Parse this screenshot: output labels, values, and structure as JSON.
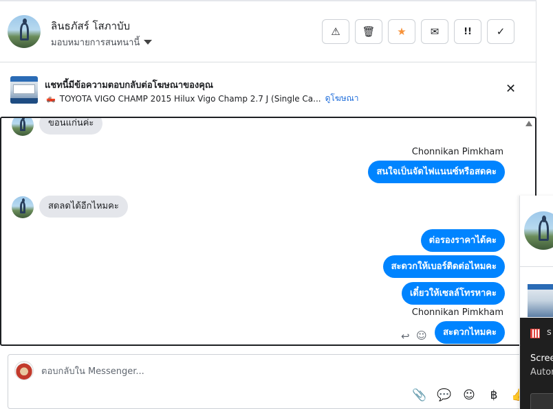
{
  "header": {
    "contact_name": "ลินธภัสร์ โสภาบับ",
    "assign_label": "มอบหมายการสนทนานี้",
    "tools": [
      {
        "icon": "warning-icon",
        "glyph": "⚠"
      },
      {
        "icon": "trash-icon",
        "glyph": "🗑"
      },
      {
        "icon": "star-icon",
        "glyph": "★"
      },
      {
        "icon": "envelope-icon",
        "glyph": "✉"
      },
      {
        "icon": "priority-icon",
        "glyph": "!!"
      },
      {
        "icon": "check-icon",
        "glyph": "✓"
      }
    ]
  },
  "ad_notice": {
    "title": "แชทนี้มีข้อความตอบกลับต่อโฆษณาของคุณ",
    "ad_text": "TOYOTA VIGO CHAMP 2015 Hilux Vigo Champ 2.7 J (Single Ca...",
    "link": "ดูโฆษณา",
    "close_glyph": "✕"
  },
  "messages": {
    "in_1": "ขอนแก่นค่ะ",
    "sender_1": "Chonnikan Pimkham",
    "out_1": "สนใจเป็นจัดไฟแนนซ์หรือสดคะ",
    "in_2": "สดลดได้อีกไหมคะ",
    "out_2": "ต่อรองราคาได้คะ",
    "out_3": "สะดวกให้เบอร์ติดต่อไหมคะ",
    "out_4": "เดี๋ยวให้เซลล์โทรหาคะ",
    "sender_2": "Chonnikan Pimkham",
    "out_5": "สะดวกไหมคะ",
    "reply_glyph": "↩",
    "emoji_glyph": "☺"
  },
  "composer": {
    "placeholder": "ตอบกลับใน Messenger...",
    "tools": [
      {
        "icon": "attachment-icon",
        "glyph": "📎"
      },
      {
        "icon": "saved-replies-icon",
        "glyph": "💬"
      },
      {
        "icon": "emoji-icon",
        "glyph": "☺"
      },
      {
        "icon": "baht-icon",
        "glyph": "฿"
      },
      {
        "icon": "thumbs-up-icon",
        "glyph": "👍"
      }
    ]
  },
  "side_panel": {
    "notice_s": "s",
    "notice_line1": "Scree",
    "notice_line2": "Autor"
  },
  "colors": {
    "accent": "#0084ff",
    "star": "#f7923a",
    "link": "#216fdb"
  }
}
